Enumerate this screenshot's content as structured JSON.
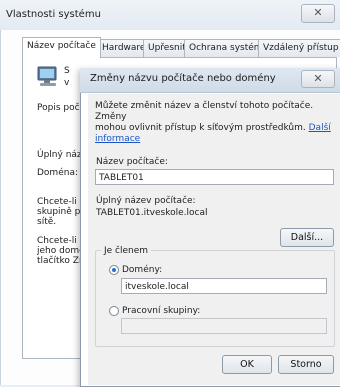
{
  "background_window": {
    "title": "Vlastnosti systému",
    "close_glyph": "✕",
    "tabs": [
      "Název počítače",
      "Hardware",
      "Upřesnit",
      "Ochrana systému",
      "Vzdálený přístup"
    ],
    "partial_texts": {
      "icon_line1": "S",
      "icon_line2": "v",
      "popis": "Popis počít",
      "uplny": "Úplný náze",
      "domena": "Doména:",
      "chcete1_l1": "Chcete-li př",
      "chcete1_l2": "skupině por",
      "chcete1_l3": "sítě.",
      "chcete2_l1": "Chcete-li př",
      "chcete2_l2": "jeho doméni",
      "chcete2_l3": "tlačítko Zm"
    }
  },
  "dialog": {
    "title": "Změny názvu počítače nebo domény",
    "close_glyph": "✕",
    "description_line1": "Můžete změnit název a členství tohoto počítače. Změny",
    "description_line2": "mohou ovlivnit přístup k síťovým prostředkům.",
    "more_info_link": "Další informace",
    "computer_name_label": "Název počítače:",
    "computer_name_value": "TABLET01",
    "full_name_label": "Úplný název počítače:",
    "full_name_value": "TABLET01.itveskole.local",
    "more_button": "Další...",
    "member_of_label": "Je členem",
    "domain_label": "Domény:",
    "domain_value": "itveskole.local",
    "domain_selected": true,
    "workgroup_label": "Pracovní skupiny:",
    "workgroup_value": "",
    "ok_button": "OK",
    "cancel_button": "Storno"
  }
}
